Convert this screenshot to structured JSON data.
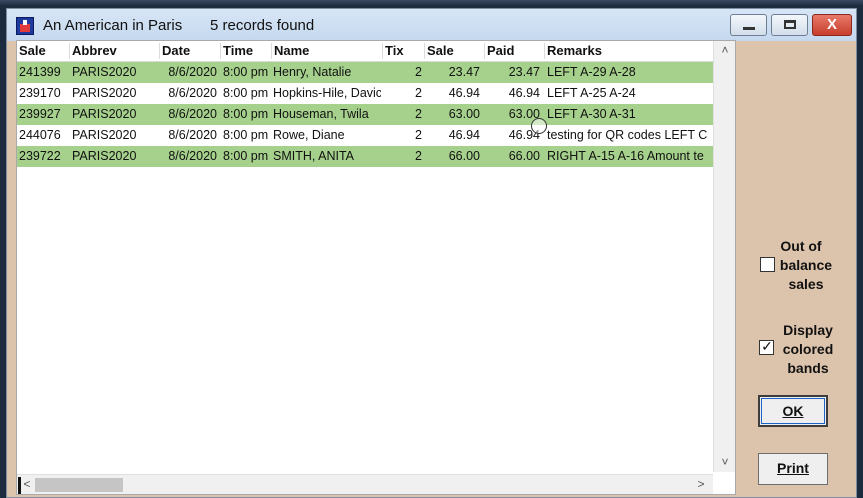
{
  "window": {
    "title": "An American in Paris",
    "records_found": "5 records found",
    "controls": {
      "minimize": "–",
      "maximize": "□",
      "close": "X"
    }
  },
  "grid": {
    "columns": [
      "Sale",
      "Abbrev",
      "Date",
      "Time",
      "Name",
      "Tix",
      "Sale",
      "Paid",
      "Remarks"
    ],
    "rows": [
      {
        "sale_id": "241399",
        "abbrev": "PARIS2020",
        "date": "8/6/2020",
        "time": "8:00 pm",
        "name": "Henry, Natalie",
        "tix": "2",
        "sale": "23.47",
        "paid": "23.47",
        "remarks": "LEFT A-29 A-28",
        "banded": true
      },
      {
        "sale_id": "239170",
        "abbrev": "PARIS2020",
        "date": "8/6/2020",
        "time": "8:00 pm",
        "name": "Hopkins-Hile, Davic",
        "tix": "2",
        "sale": "46.94",
        "paid": "46.94",
        "remarks": "LEFT A-25 A-24",
        "banded": false
      },
      {
        "sale_id": "239927",
        "abbrev": "PARIS2020",
        "date": "8/6/2020",
        "time": "8:00 pm",
        "name": "Houseman, Twila",
        "tix": "2",
        "sale": "63.00",
        "paid": "63.00",
        "remarks": "LEFT A-30 A-31",
        "banded": true
      },
      {
        "sale_id": "244076",
        "abbrev": "PARIS2020",
        "date": "8/6/2020",
        "time": "8:00 pm",
        "name": "Rowe, Diane",
        "tix": "2",
        "sale": "46.94",
        "paid": "46.94",
        "remarks": "testing for QR codes LEFT C",
        "banded": false
      },
      {
        "sale_id": "239722",
        "abbrev": "PARIS2020",
        "date": "8/6/2020",
        "time": "8:00 pm",
        "name": "SMITH, ANITA",
        "tix": "2",
        "sale": "66.00",
        "paid": "66.00",
        "remarks": "RIGHT A-15 A-16 Amount te",
        "banded": true
      }
    ],
    "band_color": "#a6d18c"
  },
  "scroll": {
    "up": "˄",
    "down": "˅",
    "left": "<",
    "right": ">"
  },
  "options": {
    "out_of_balance": {
      "label_lines": [
        "Out of",
        "balance",
        "sales"
      ],
      "checked": false,
      "mark": ""
    },
    "display_colored_bands": {
      "label_lines": [
        "Display",
        "colored",
        "bands"
      ],
      "checked": true,
      "mark": "✓"
    }
  },
  "buttons": {
    "ok": "OK",
    "print": "Print"
  }
}
